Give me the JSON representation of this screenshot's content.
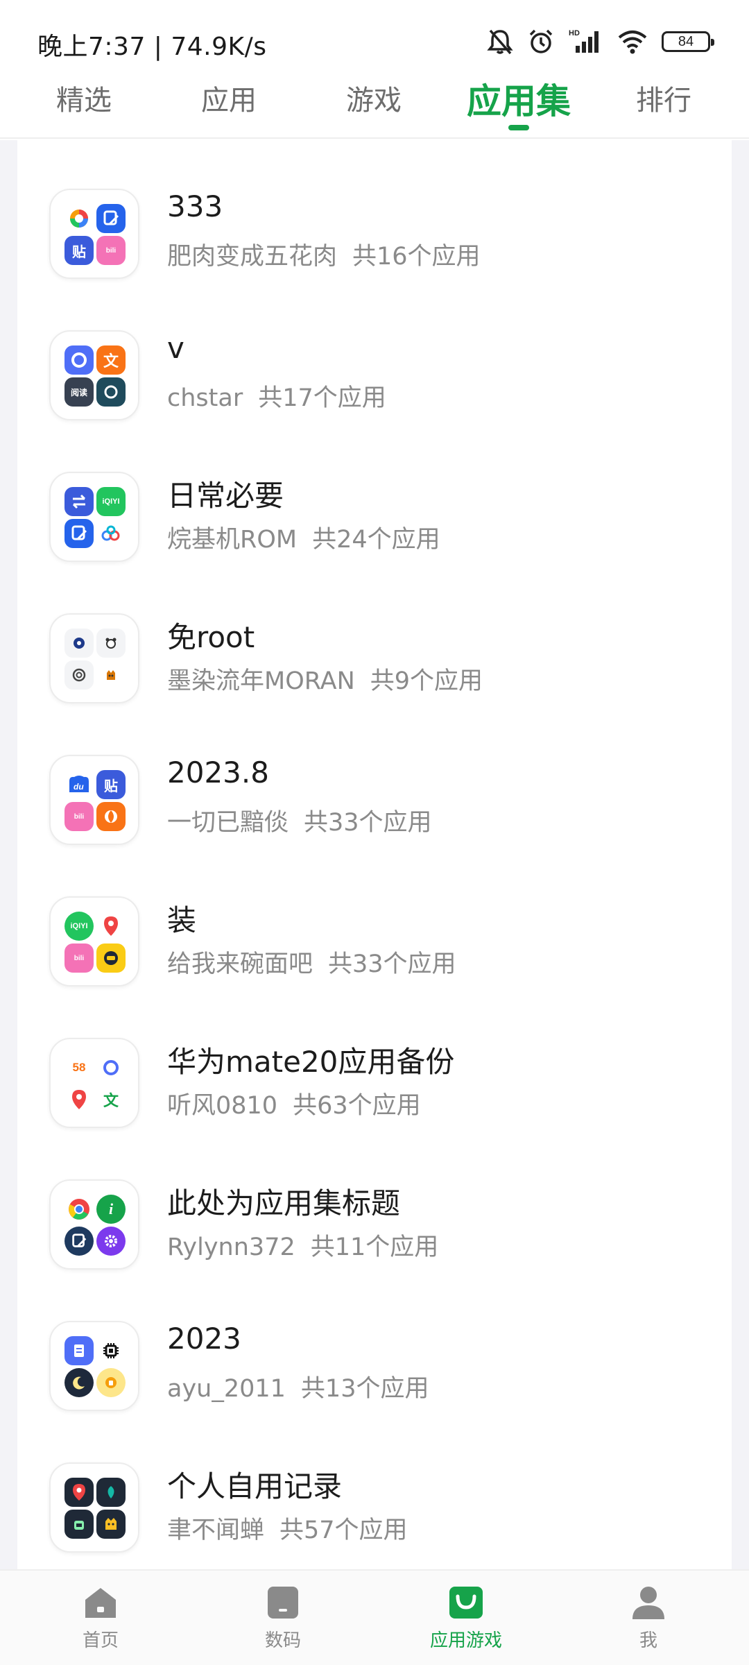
{
  "status": {
    "time": "晚上7:37 | 74.9K/s",
    "battery": "84",
    "icons": [
      "bell-off-icon",
      "alarm-icon",
      "hd-signal-icon",
      "wifi-icon",
      "battery-icon"
    ]
  },
  "tabs": [
    {
      "label": "精选",
      "active": false
    },
    {
      "label": "应用",
      "active": false
    },
    {
      "label": "游戏",
      "active": false
    },
    {
      "label": "应用集",
      "active": true
    },
    {
      "label": "排行",
      "active": false
    }
  ],
  "colors": {
    "accent": "#16a34a",
    "muted": "#8a8a8a",
    "background": "#f3f3f7"
  },
  "collections": [
    {
      "title": "333",
      "author": "肥肉变成五花肉",
      "count": "共16个应用"
    },
    {
      "title": "v",
      "author": "chstar",
      "count": "共17个应用"
    },
    {
      "title": "日常必要",
      "author": "烷基机ROM",
      "count": "共24个应用"
    },
    {
      "title": "免root",
      "author": "墨染流年MORAN",
      "count": "共9个应用"
    },
    {
      "title": "2023.8",
      "author": "一切已黯倓",
      "count": "共33个应用"
    },
    {
      "title": "装",
      "author": "给我来碗面吧",
      "count": "共33个应用"
    },
    {
      "title": "华为mate20应用备份",
      "author": "听风0810",
      "count": "共63个应用"
    },
    {
      "title": "此处为应用集标题",
      "author": "Rylynn372",
      "count": "共11个应用"
    },
    {
      "title": "2023",
      "author": "ayu_2011",
      "count": "共13个应用"
    },
    {
      "title": "个人自用记录",
      "author": "聿不闻蝉",
      "count": "共57个应用"
    }
  ],
  "bottom_nav": [
    {
      "label": "首页",
      "icon": "home-icon",
      "active": false
    },
    {
      "label": "数码",
      "icon": "device-icon",
      "active": false
    },
    {
      "label": "应用游戏",
      "icon": "app-store-bag-icon",
      "active": true
    },
    {
      "label": "我",
      "icon": "profile-icon",
      "active": false
    }
  ]
}
